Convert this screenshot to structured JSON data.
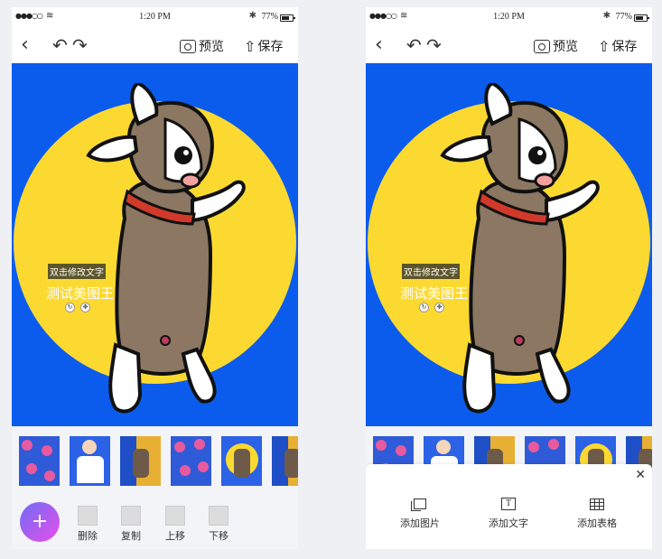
{
  "status_bar": {
    "time": "1:20 PM",
    "battery": "77%"
  },
  "nav": {
    "preview_label": "预览",
    "save_label": "保存"
  },
  "canvas": {
    "caption": "双击修改文字",
    "title_text": "测试美图王"
  },
  "toolbar": {
    "delete_label": "删除",
    "copy_label": "复制",
    "move_up_label": "上移",
    "move_down_label": "下移",
    "add_button_icon": "plus-icon"
  },
  "sheet": {
    "add_image_label": "添加图片",
    "add_text_label": "添加文字",
    "add_table_label": "添加表格",
    "close_icon": "close-icon"
  },
  "colors": {
    "canvas_bg": "#0b5cec",
    "sun": "#fcd930",
    "fab_start": "#6f6cf7",
    "fab_end": "#e84fe8"
  }
}
